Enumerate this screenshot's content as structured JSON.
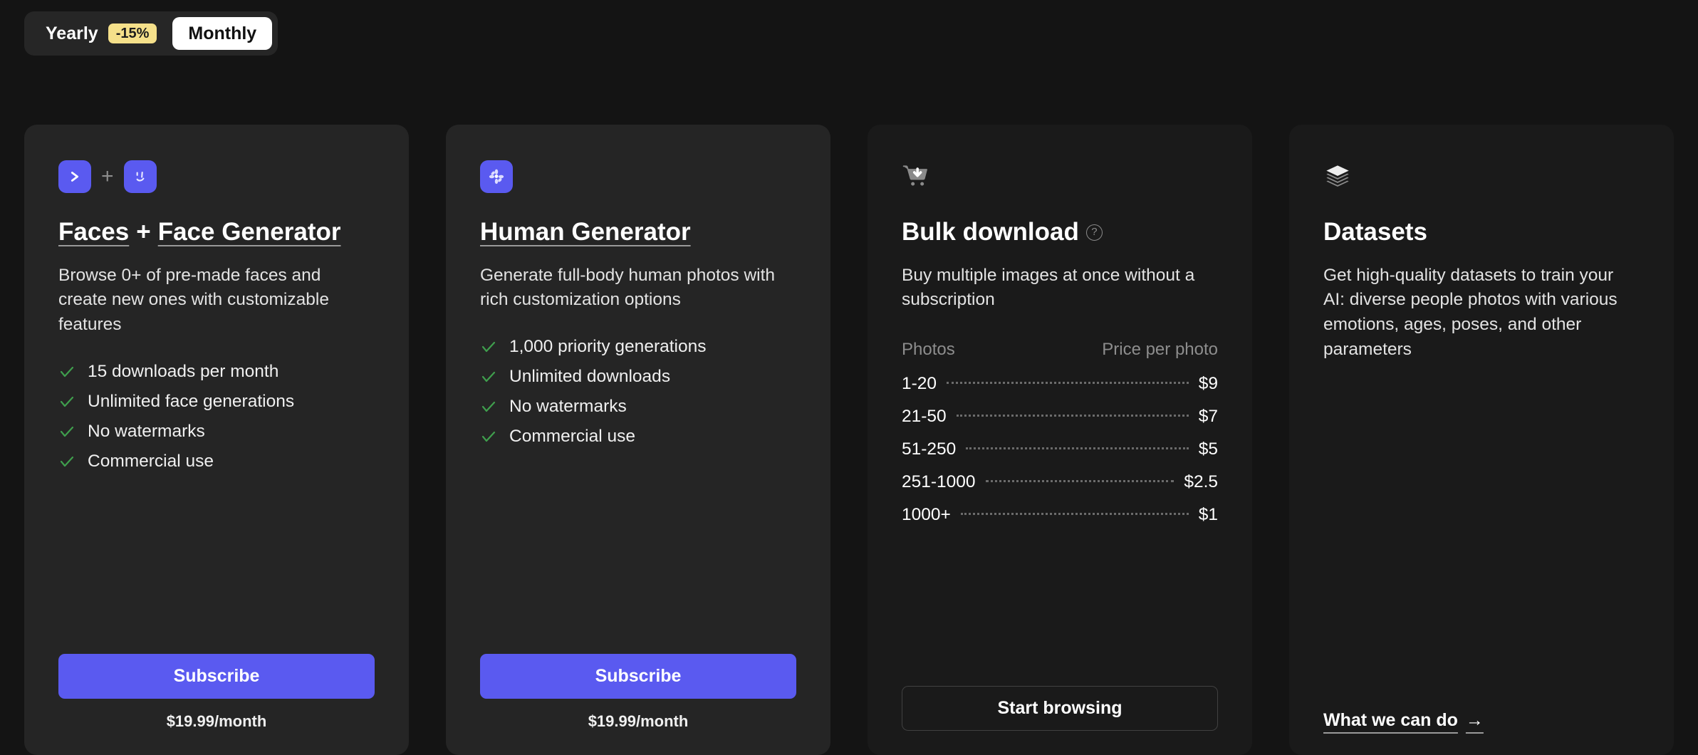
{
  "billing_toggle": {
    "yearly_label": "Yearly",
    "yearly_badge": "-15%",
    "monthly_label": "Monthly",
    "active": "Monthly"
  },
  "colors": {
    "accent": "#5a5af0",
    "badge": "#f5e08a",
    "check": "#3f9e4d",
    "page_bg": "#141414",
    "card_sub_bg": "#252525",
    "card_plain_bg": "#1a1a1a"
  },
  "cards": [
    {
      "id": "faces-face-generator",
      "icons": [
        "chevron-app-icon",
        "plus-icon",
        "smiley-face-app-icon"
      ],
      "title_parts": [
        "Faces",
        "+",
        "Face Generator"
      ],
      "description": "Browse 0+ of pre-made faces and create new ones with customizable features",
      "features": [
        "15 downloads per month",
        "Unlimited face generations",
        "No watermarks",
        "Commercial use"
      ],
      "cta_label": "Subscribe",
      "price_note": "$19.99/month"
    },
    {
      "id": "human-generator",
      "icons": [
        "human-generator-app-icon"
      ],
      "title_parts": [
        "Human Generator"
      ],
      "description": "Generate full-body human photos with rich customization options",
      "features": [
        "1,000 priority generations",
        "Unlimited downloads",
        "No watermarks",
        "Commercial use"
      ],
      "cta_label": "Subscribe",
      "price_note": "$19.99/month"
    },
    {
      "id": "bulk-download",
      "icons": [
        "cart-download-icon"
      ],
      "title_parts": [
        "Bulk download"
      ],
      "has_help_icon": true,
      "help_glyph": "?",
      "description": "Buy multiple images at once without a subscription",
      "table": {
        "col_photos": "Photos",
        "col_price": "Price per photo",
        "rows": [
          {
            "tier": "1-20",
            "price": "$9"
          },
          {
            "tier": "21-50",
            "price": "$7"
          },
          {
            "tier": "51-250",
            "price": "$5"
          },
          {
            "tier": "251-1000",
            "price": "$2.5"
          },
          {
            "tier": "1000+",
            "price": "$1"
          }
        ]
      },
      "cta_label": "Start browsing"
    },
    {
      "id": "datasets",
      "icons": [
        "layers-stack-icon"
      ],
      "title_parts": [
        "Datasets"
      ],
      "description": "Get high-quality datasets to train your AI: diverse people photos with various emotions, ages, poses, and other parameters",
      "cta_label": "What we can do",
      "cta_arrow": "→"
    }
  ]
}
